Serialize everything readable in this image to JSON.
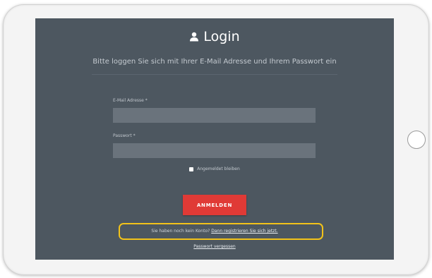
{
  "login": {
    "title": "Login",
    "icon": "user-icon",
    "subtitle": "Bitte loggen Sie sich mit Ihrer E-Mail Adresse und Ihrem Passwort ein",
    "email_label": "E-Mail Adresse *",
    "email_value": "",
    "password_label": "Passwort *",
    "password_value": "",
    "remember_label": "Angemeldet bleiben",
    "remember_checked": false,
    "submit_label": "ANMELDEN",
    "no_account_text": "Sie haben noch kein Konto?",
    "register_link": "Dann registrieren Sie sich jetzt.",
    "forgot_password_link": "Passwort vergessen"
  },
  "colors": {
    "screen_background": "#4d5760",
    "input_background": "#6a737c",
    "button": "#e03a36",
    "highlight": "#f2c21a"
  }
}
